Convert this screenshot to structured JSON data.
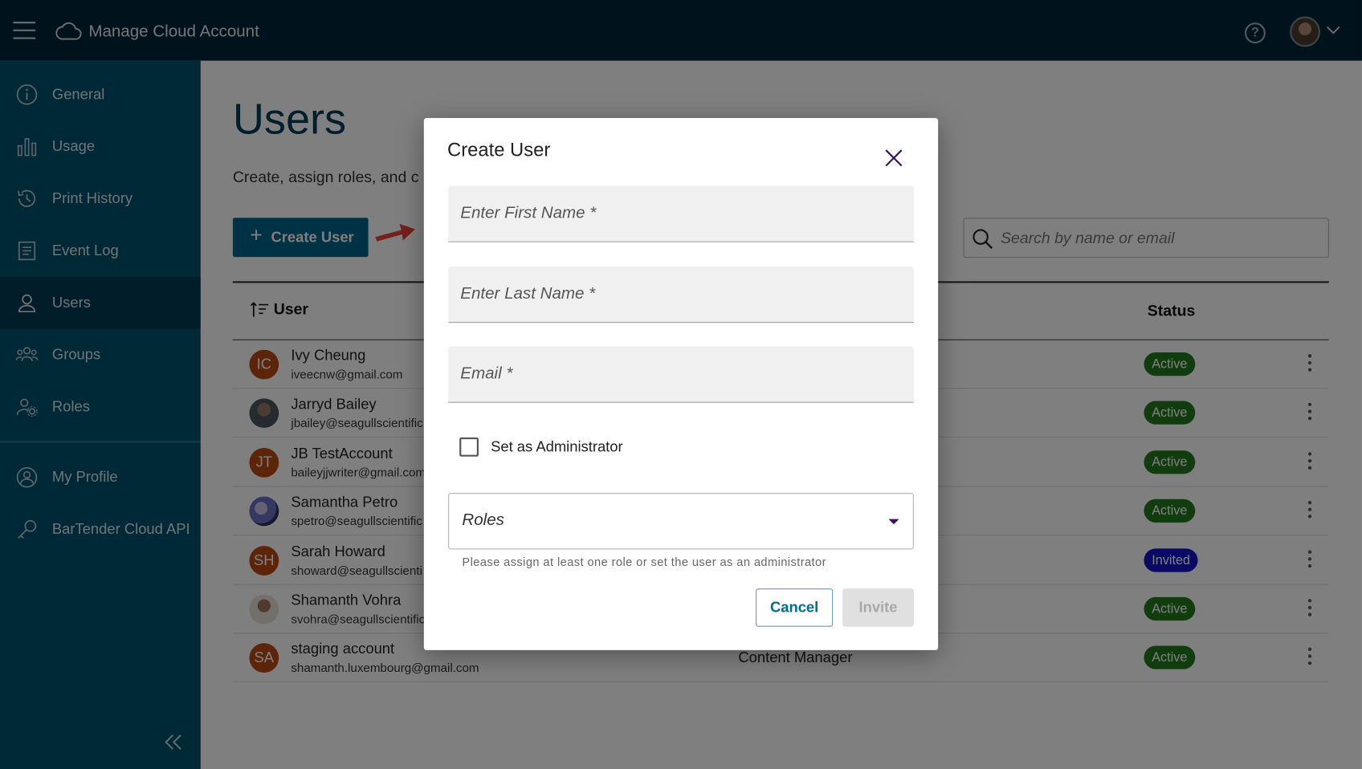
{
  "app": {
    "title": "Manage Cloud Account"
  },
  "sidebar": {
    "items": [
      {
        "label": "General",
        "icon": "info-icon"
      },
      {
        "label": "Usage",
        "icon": "bar-chart-icon"
      },
      {
        "label": "Print History",
        "icon": "history-icon"
      },
      {
        "label": "Event Log",
        "icon": "log-icon"
      },
      {
        "label": "Users",
        "icon": "user-icon",
        "active": true
      },
      {
        "label": "Groups",
        "icon": "groups-icon"
      },
      {
        "label": "Roles",
        "icon": "roles-icon"
      },
      {
        "label": "My Profile",
        "icon": "profile-icon"
      },
      {
        "label": "BarTender Cloud API",
        "icon": "key-icon"
      }
    ]
  },
  "page": {
    "title": "Users",
    "subtitle": "Create, assign roles, and c",
    "create_button": "Create User",
    "search_placeholder": "Search by name or email"
  },
  "table": {
    "col_user": "User",
    "col_status": "Status",
    "rows": [
      {
        "initials": "IC",
        "name": "Ivy Cheung",
        "email": "iveecnw@gmail.com",
        "role": "",
        "status": "Active"
      },
      {
        "initials": "",
        "name": "Jarryd Bailey",
        "email": "jbailey@seagullscientific",
        "role": "",
        "status": "Active"
      },
      {
        "initials": "JT",
        "name": "JB TestAccount",
        "email": "baileyjjwriter@gmail.com",
        "role": "",
        "status": "Active"
      },
      {
        "initials": "",
        "name": "Samantha Petro",
        "email": "spetro@seagullscientific",
        "role": "",
        "status": "Active"
      },
      {
        "initials": "SH",
        "name": "Sarah Howard",
        "email": "showard@seagullscienti",
        "role": "",
        "status": "Invited"
      },
      {
        "initials": "",
        "name": "Shamanth Vohra",
        "email": "svohra@seagullscientific",
        "role": "",
        "status": "Active"
      },
      {
        "initials": "SA",
        "name": "staging account",
        "email": "shamanth.luxembourg@gmail.com",
        "role": "Content Manager",
        "status": "Active"
      }
    ]
  },
  "modal": {
    "title": "Create User",
    "first_name_placeholder": "Enter First Name *",
    "last_name_placeholder": "Enter Last Name *",
    "email_placeholder": "Email *",
    "admin_label": "Set as Administrator",
    "roles_label": "Roles",
    "hint": "Please assign at least one role or set the user as an administrator",
    "cancel": "Cancel",
    "invite": "Invite"
  },
  "colors": {
    "topbar": "#002639",
    "sidebar": "#00536f",
    "sidebar_active": "#003a52",
    "primary": "#00658a",
    "active_badge": "#237a1c",
    "invited_badge": "#1515c9",
    "avatar_initials": "#b94a15"
  }
}
